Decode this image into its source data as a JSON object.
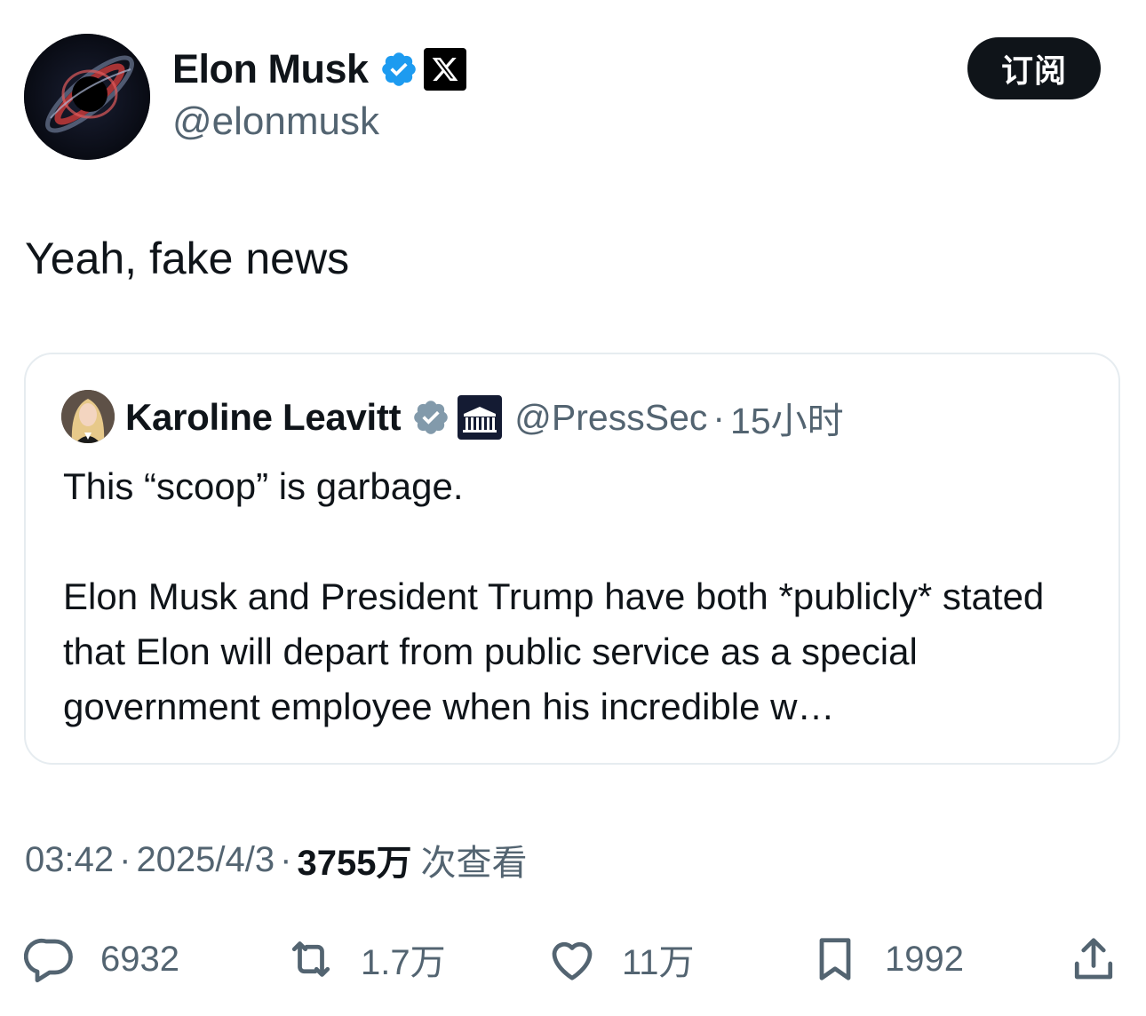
{
  "author": {
    "name": "Elon Musk",
    "handle": "@elonmusk"
  },
  "subscribe_label": "订阅",
  "tweet": {
    "text": "Yeah, fake news"
  },
  "quoted": {
    "name": "Karoline Leavitt",
    "handle": "@PressSec",
    "dot": "·",
    "time": "15小时",
    "line1": "This “scoop” is garbage.",
    "line2": "Elon Musk and President Trump have both *publicly* stated that Elon will depart from public service as a special government employee when his incredible w…"
  },
  "meta": {
    "time": "03:42",
    "sep": "·",
    "date": "2025/4/3",
    "views": "3755万",
    "views_label": "次查看"
  },
  "actions": {
    "replies": "6932",
    "reposts": "1.7万",
    "likes": "11万",
    "bookmarks": "1992"
  },
  "colors": {
    "verified_blue": "#1d9bf0",
    "verified_grey": "#829aab",
    "muted": "#536471",
    "text": "#0f1419"
  },
  "icons": [
    "verified-icon",
    "x-logo-icon",
    "white-house-icon",
    "reply-icon",
    "repost-icon",
    "like-icon",
    "bookmark-icon",
    "share-icon"
  ]
}
